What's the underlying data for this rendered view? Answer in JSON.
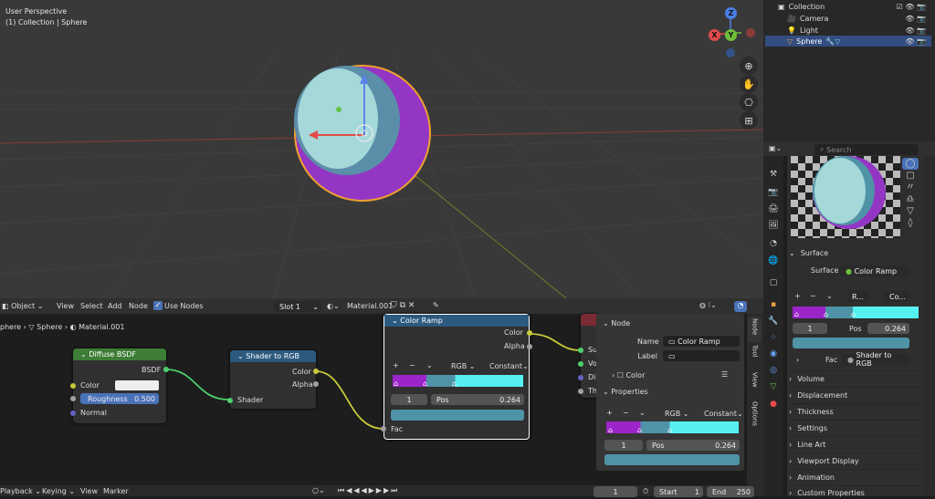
{
  "viewport": {
    "perspective": "User Perspective",
    "collection_label": "(1) Collection | Sphere",
    "axis_x": "X",
    "axis_y": "Y",
    "axis_z": "Z"
  },
  "outliner": {
    "collection": "Collection",
    "items": [
      "Camera",
      "Light",
      "Sphere"
    ]
  },
  "properties": {
    "search_placeholder": "Search",
    "surface_section": "Surface",
    "surface_label": "Surface",
    "surface_value": "Color Ramp",
    "ramp_mode": "R...",
    "ramp_interp": "Co...",
    "stop_index": "1",
    "pos_label": "Pos",
    "pos_value": "0.264",
    "fac_label": "Fac",
    "fac_value": "Shader to RGB",
    "sections": [
      "Volume",
      "Displacement",
      "Thickness",
      "Settings",
      "Line Art",
      "Viewport Display",
      "Animation",
      "Custom Properties"
    ]
  },
  "node_editor": {
    "header": {
      "mode": "Object",
      "view": "View",
      "select": "Select",
      "add": "Add",
      "node": "Node",
      "use_nodes": "Use Nodes",
      "slot": "Slot 1",
      "material": "Material.001"
    },
    "breadcrumb": {
      "obj": "phere",
      "mesh": "Sphere",
      "mat": "Material.001"
    },
    "diffuse": {
      "title": "Diffuse BSDF",
      "out": "BSDF",
      "color": "Color",
      "roughness": "Roughness",
      "roughness_val": "0.500",
      "normal": "Normal"
    },
    "shader_rgb": {
      "title": "Shader to RGB",
      "color": "Color",
      "alpha": "Alpha",
      "shader": "Shader"
    },
    "color_ramp": {
      "title": "Color Ramp",
      "color": "Color",
      "alpha": "Alpha",
      "mode": "RGB",
      "interp": "Constant",
      "index": "1",
      "pos_label": "Pos",
      "pos_value": "0.264",
      "fac": "Fac"
    },
    "output_node": {
      "s1": "Su",
      "s2": "Vo",
      "s3": "Di",
      "s4": "Th"
    },
    "npanel": {
      "node_section": "Node",
      "name_label": "Name",
      "name_value": "Color Ramp",
      "label_label": "Label",
      "color_label": "Color",
      "properties_section": "Properties",
      "mode": "RGB",
      "interp": "Constant",
      "index": "1",
      "pos_label": "Pos",
      "pos_value": "0.264"
    },
    "side_tabs": [
      "Node",
      "Tool",
      "View",
      "Options"
    ]
  },
  "timeline": {
    "playback": "Playback",
    "keying": "Keying",
    "view": "View",
    "marker": "Marker",
    "frame": "1",
    "start_label": "Start",
    "start_val": "1",
    "end_label": "End",
    "end_val": "250"
  }
}
